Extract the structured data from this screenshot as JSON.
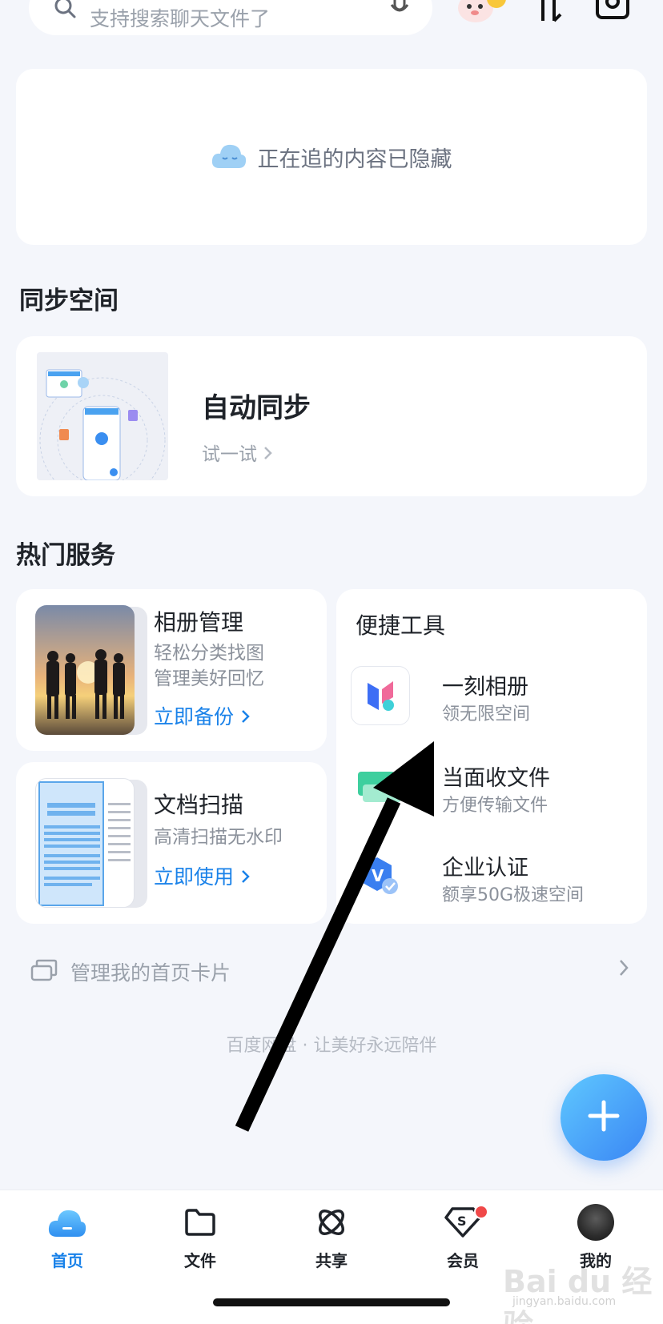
{
  "search": {
    "placeholder": "支持搜索聊天文件了",
    "icon": "search-icon",
    "mic_icon": "microphone-icon"
  },
  "header": {
    "mascot_icon": "mascot-icon",
    "transfer_icon": "transfer-icon",
    "camera_icon": "camera-icon"
  },
  "hidden_card": {
    "icon": "sleeping-cloud-icon",
    "text": "正在追的内容已隐藏"
  },
  "sync_section": {
    "title": "同步空间",
    "card_title": "自动同步",
    "card_link": "试一试"
  },
  "hot_services": {
    "title": "热门服务",
    "album": {
      "title": "相册管理",
      "desc_line1": "轻松分类找图",
      "desc_line2": "管理美好回忆",
      "link": "立即备份"
    },
    "doc_scan": {
      "title": "文档扫描",
      "desc": "高清扫描无水印",
      "link": "立即使用"
    },
    "tools": {
      "title": "便捷工具",
      "items": [
        {
          "name": "一刻相册",
          "desc": "领无限空间",
          "icon": "yike-album-icon"
        },
        {
          "name": "当面收文件",
          "desc": "方便传输文件",
          "icon": "receive-file-icon"
        },
        {
          "name": "企业认证",
          "desc": "额享50G极速空间",
          "icon": "enterprise-verify-icon"
        }
      ]
    }
  },
  "manage_cards": {
    "text": "管理我的首页卡片"
  },
  "slogan": "百度网盘 · 让美好永远陪伴",
  "fab": {
    "icon": "plus-icon"
  },
  "tabbar": {
    "tabs": [
      {
        "label": "首页",
        "icon": "home-cloud-icon",
        "active": true
      },
      {
        "label": "文件",
        "icon": "folder-icon",
        "active": false
      },
      {
        "label": "共享",
        "icon": "share-orbit-icon",
        "active": false
      },
      {
        "label": "会员",
        "icon": "vip-diamond-icon",
        "active": false
      },
      {
        "label": "我的",
        "icon": "avatar",
        "active": false
      }
    ]
  },
  "watermark": {
    "main": "Bai du 经验",
    "sub": "jingyan.baidu.com"
  },
  "colors": {
    "accent": "#1a82e9",
    "background": "#f4f6fb",
    "badge": "#f04848",
    "arrow": "#000000"
  }
}
